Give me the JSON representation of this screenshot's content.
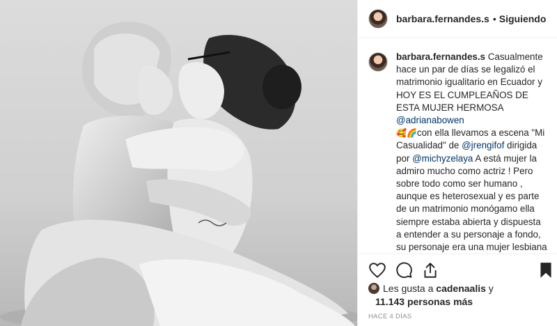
{
  "post": {
    "username": "barbara.fernandes.s",
    "separator": "•",
    "follow_state": "Siguiendo"
  },
  "caption": {
    "username": "barbara.fernandes.s",
    "part1": " Casualmente hace un par de días se legalizó el matrimonio igualitario en Ecuador y HOY ES EL CUMPLEAÑOS DE ESTA MUJER HERMOSA ",
    "mention1": "@adrianabowen",
    "emojis": "🥰🌈",
    "part2": "con ella llevamos a escena \"Mi Casualidad\" de ",
    "mention2": "@jrengifof",
    "part3": " dirigida por ",
    "mention3": "@michyzelaya",
    "part4": " A está mujer la admiro mucho como actriz ! Pero sobre todo como ser humano , aunque es heterosexual y es parte de un matrimonio monógamo ella siempre estaba abierta y dispuesta a entender a su personaje a fondo, su personaje era una mujer lesbiana que tenía una relación heterosexual por miedo al qué dirán, Adriana no se dejó llevar por ciertas críticas o"
  },
  "actions": {
    "icons": [
      "heart-icon",
      "comment-icon",
      "share-icon",
      "bookmark-icon"
    ]
  },
  "likes": {
    "prefix": "Les gusta a ",
    "user": "cadenaalis",
    "connector": " y",
    "count": "11.143 personas más"
  },
  "timestamp": "HACE 4 DÍAS"
}
